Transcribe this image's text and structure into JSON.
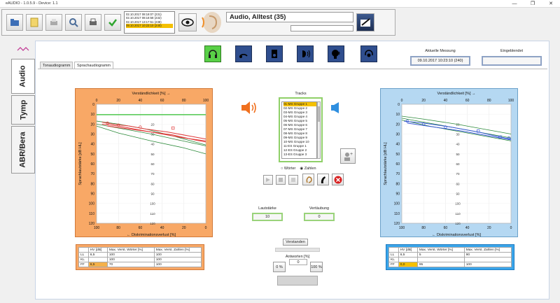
{
  "window": {
    "title": "eAUDIO - 1.0.5.9 - Device: 1.1",
    "min": "—",
    "max": "❐",
    "close": "✕"
  },
  "toolbar": {
    "buttons": [
      {
        "name": "patient-folder-icon",
        "color": "#3d6fb7"
      },
      {
        "name": "notes-icon",
        "color": "#e9c546"
      },
      {
        "name": "print-preview-icon",
        "color": "#8a8a8a"
      },
      {
        "name": "search-icon",
        "color": "#6b83a3"
      },
      {
        "name": "printer-icon",
        "color": "#5a5a5a"
      },
      {
        "name": "checkmark-icon",
        "color": "#2fa52f"
      }
    ],
    "history": [
      "02.10.2017 08:18:07 (231)",
      "02.10.2017 08:18:58 (232)",
      "02.10.2017 13:17:51 (238)",
      "09.10.2017 10:23:10 (240)"
    ],
    "history_selected": 3
  },
  "patient": {
    "name": "Audio, Alltest (35)"
  },
  "left_tabs": [
    "Audio",
    "Tymp",
    "ABR/Bera"
  ],
  "mode_icons": [
    "headphones-icon",
    "bone-conduction-icon",
    "speaker-box-icon",
    "free-field-icon",
    "speech-head-icon",
    "headphone-ear-icon"
  ],
  "measurement": {
    "current_label": "Aktuelle Messung",
    "current_value": "09.10.2017 10:23:10 (240)",
    "overlay_label": "Eingeblendet",
    "overlay_value": ""
  },
  "tabs": [
    "Tonaudiogramm",
    "Sprachaudiogramm"
  ],
  "active_tab": 1,
  "chart_data": [
    {
      "type": "line",
      "side": "left",
      "title": "Verständlichkeit [%] →",
      "xlabel": "← Diskriminationsverlust [%]",
      "ylabel": "Sprachlautstärke [dB HL]",
      "x_top_ticks": [
        "0",
        "20",
        "40",
        "60",
        "80",
        "100"
      ],
      "x_bottom_ticks": [
        "100",
        "80",
        "60",
        "40",
        "20",
        "0"
      ],
      "y_ticks": [
        "0",
        "10",
        "20",
        "30",
        "40",
        "50",
        "60",
        "70",
        "80",
        "90",
        "100",
        "110",
        "120"
      ],
      "ylim": [
        0,
        120
      ],
      "xlim": [
        0,
        100
      ],
      "series": [
        {
          "color": "#2fbf2f",
          "width": 1.2,
          "points": [
            [
              0,
              10.5
            ],
            [
              100,
              10.5
            ]
          ]
        },
        {
          "color": "#2c8a3a",
          "width": 0.8,
          "points": [
            [
              0,
              17
            ],
            [
              20,
              20
            ],
            [
              45,
              25
            ],
            [
              70,
              32
            ],
            [
              90,
              38
            ],
            [
              100,
              41
            ]
          ]
        },
        {
          "color": "#2c8a3a",
          "width": 0.8,
          "points": [
            [
              0,
              20
            ],
            [
              20,
              24
            ],
            [
              50,
              30
            ],
            [
              75,
              36
            ],
            [
              100,
              42
            ]
          ]
        },
        {
          "color": "#2c8a3a",
          "width": 0.8,
          "points": [
            [
              0,
              22
            ],
            [
              20,
              29
            ],
            [
              50,
              37
            ],
            [
              80,
              44
            ],
            [
              100,
              50
            ]
          ]
        },
        {
          "color": "#e03a3a",
          "width": 1.0,
          "points": [
            [
              5,
              18
            ],
            [
              15,
              20
            ],
            [
              30,
              22
            ],
            [
              45,
              25
            ],
            [
              65,
              28
            ],
            [
              85,
              32
            ],
            [
              100,
              35
            ]
          ]
        },
        {
          "color": "#e03a3a",
          "width": 1.0,
          "points": [
            [
              5,
              20
            ],
            [
              20,
              22
            ],
            [
              40,
              26
            ],
            [
              60,
              30
            ],
            [
              80,
              34
            ],
            [
              100,
              37
            ]
          ]
        },
        {
          "color": "#e03a3a",
          "width": 1.0,
          "points": [
            [
              10,
              22
            ],
            [
              30,
              25
            ],
            [
              50,
              28
            ],
            [
              70,
              31
            ],
            [
              90,
              36
            ],
            [
              100,
              38
            ]
          ]
        }
      ],
      "markers": [
        {
          "shape": "circle",
          "x": 10,
          "y": 19,
          "color": "#e03a3a"
        },
        {
          "shape": "circle",
          "x": 20,
          "y": 21,
          "color": "#e03a3a"
        },
        {
          "shape": "circle",
          "x": 40,
          "y": 23,
          "color": "#e03a3a"
        },
        {
          "shape": "square",
          "x": 70,
          "y": 24,
          "color": "#e03a3a"
        }
      ]
    },
    {
      "type": "line",
      "side": "right",
      "title": "Verständlichkeit [%] →",
      "xlabel": "← Diskriminationsverlust [%]",
      "ylabel": "Sprachlautstärke [dB HL]",
      "x_top_ticks": [
        "0",
        "20",
        "40",
        "60",
        "80",
        "100"
      ],
      "x_bottom_ticks": [
        "100",
        "80",
        "60",
        "40",
        "20",
        "0"
      ],
      "y_ticks": [
        "0",
        "10",
        "20",
        "30",
        "40",
        "50",
        "60",
        "70",
        "80",
        "90",
        "100",
        "110",
        "120"
      ],
      "ylim": [
        0,
        120
      ],
      "xlim": [
        0,
        100
      ],
      "series": [
        {
          "color": "#2c8a3a",
          "width": 0.8,
          "points": [
            [
              0,
              12
            ],
            [
              20,
              15
            ],
            [
              50,
              20
            ],
            [
              80,
              26
            ],
            [
              100,
              30
            ]
          ]
        },
        {
          "color": "#2c8a3a",
          "width": 0.8,
          "points": [
            [
              0,
              14
            ],
            [
              20,
              18
            ],
            [
              50,
              24
            ],
            [
              80,
              30
            ],
            [
              100,
              34
            ]
          ]
        },
        {
          "color": "#2c8a3a",
          "width": 0.8,
          "points": [
            [
              0,
              16
            ],
            [
              25,
              22
            ],
            [
              55,
              28
            ],
            [
              85,
              34
            ],
            [
              100,
              37
            ]
          ]
        },
        {
          "color": "#3a5ad8",
          "width": 1.0,
          "points": [
            [
              2,
              17
            ],
            [
              20,
              19
            ],
            [
              45,
              23
            ],
            [
              70,
              28
            ],
            [
              90,
              33
            ],
            [
              100,
              35
            ]
          ]
        },
        {
          "color": "#3a5ad8",
          "width": 1.0,
          "points": [
            [
              5,
              19
            ],
            [
              30,
              23
            ],
            [
              55,
              27
            ],
            [
              80,
              32
            ],
            [
              100,
              36
            ]
          ]
        }
      ],
      "markers": [
        {
          "shape": "circle",
          "x": 5,
          "y": 17,
          "color": "#3a5ad8"
        },
        {
          "shape": "circle",
          "x": 20,
          "y": 20,
          "color": "#3a5ad8"
        },
        {
          "shape": "circle",
          "x": 40,
          "y": 23,
          "color": "#3a5ad8"
        },
        {
          "shape": "square",
          "x": 70,
          "y": 27,
          "color": "#3a5ad8"
        },
        {
          "shape": "square",
          "x": 90,
          "y": 33,
          "color": "#3a5ad8"
        },
        {
          "shape": "circle",
          "x": 98,
          "y": 34,
          "color": "#3a5ad8"
        }
      ]
    }
  ],
  "tracks": {
    "label": "Tracks",
    "items": [
      "01-MS Gruppe 1",
      "02-MS Gruppe 2",
      "03-MS Gruppe 3",
      "04-MS Gruppe 4",
      "05-MS Gruppe 5",
      "06-MS Gruppe 6",
      "07-MS Gruppe 7",
      "08-MS Gruppe 8",
      "09-MS Gruppe 9",
      "10-MS Gruppe 10",
      "11-ES Gruppe 1",
      "12-ES Gruppe 2",
      "13-ES Gruppe 3"
    ],
    "selected": 0
  },
  "mode_radio": {
    "words": "Wörter",
    "numbers": "Zahlen",
    "selected": "numbers"
  },
  "controls": [
    "play-icon",
    "stop-icon",
    "pause-icon",
    "ear-icon",
    "hearing-aid-icon",
    "cancel-icon"
  ],
  "loudness": {
    "label": "Lautstärke",
    "value": "10"
  },
  "masking": {
    "label": "Vertäubung",
    "value": "0"
  },
  "understood_button": "Verstanden",
  "answers": {
    "label": "Antworten [%]",
    "value": "0",
    "zero": "0 %",
    "hundred": "100 %"
  },
  "table_left": {
    "headers": [
      "",
      "HV [dB]",
      "Max. Verst. Wörter [%]",
      "Max. Verst. Zahlen [%]"
    ],
    "rows": [
      [
        "LL",
        "6,5",
        "100",
        "100"
      ],
      [
        "KL",
        "",
        "100",
        "100"
      ],
      [
        "FF",
        "6,5",
        "70",
        "100"
      ]
    ]
  },
  "table_right": {
    "headers": [
      "",
      "HV [dB]",
      "Max. Verst. Wörter [%]",
      "Max. Verst. Zahlen [%]"
    ],
    "rows": [
      [
        "LL",
        "6,5",
        "5",
        "90"
      ],
      [
        "KL",
        "",
        "",
        ""
      ],
      [
        "FF",
        "0,0",
        "95",
        "100"
      ]
    ]
  }
}
